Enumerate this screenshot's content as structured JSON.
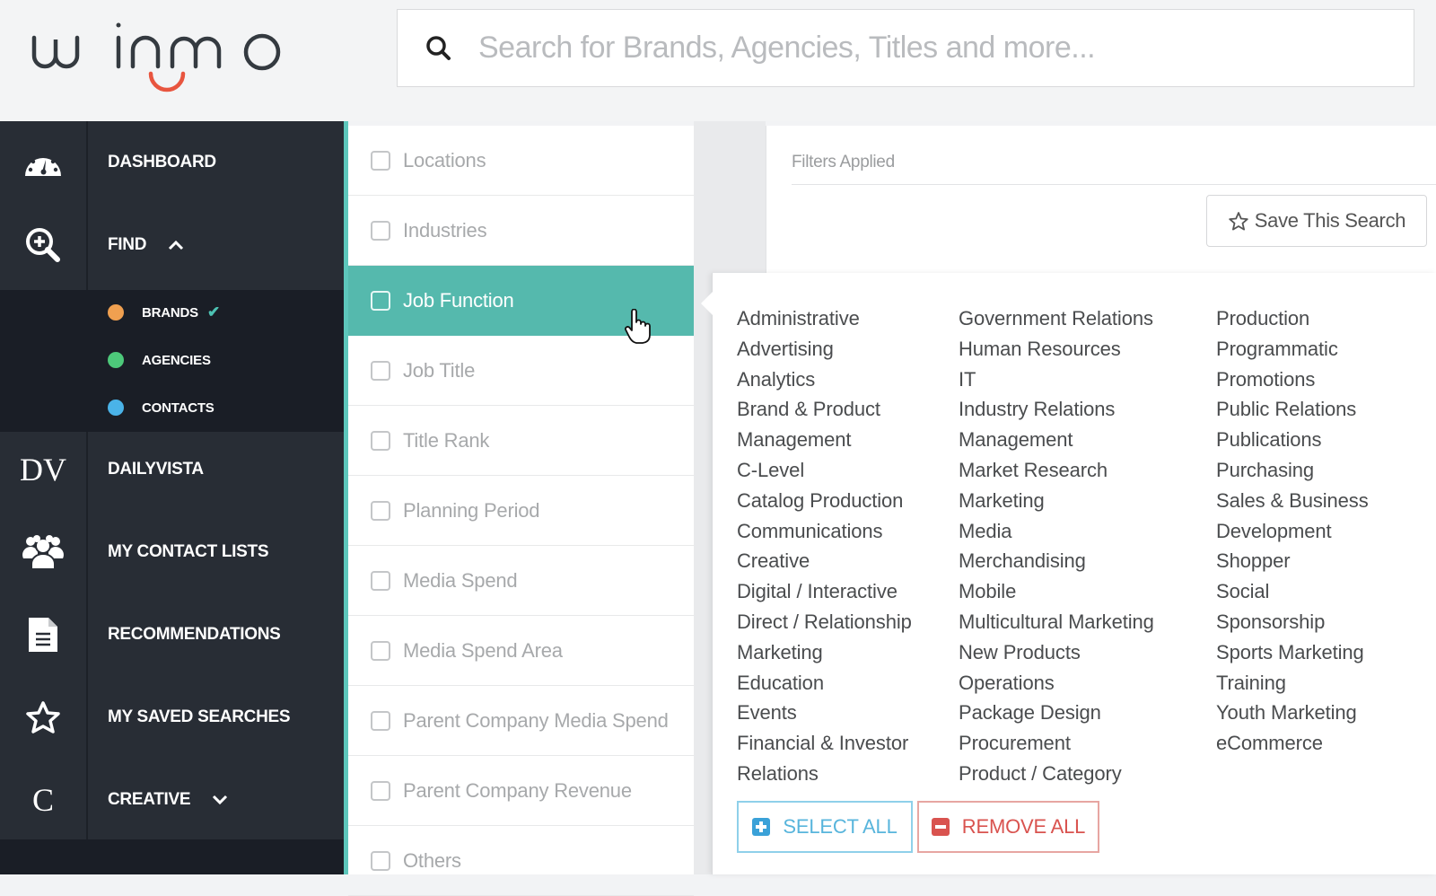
{
  "brand": {
    "name": "winmo"
  },
  "search": {
    "placeholder": "Search for Brands, Agencies, Titles and more..."
  },
  "sidebar": {
    "items": [
      {
        "label": "DASHBOARD",
        "icon": "dashboard-gauge-icon"
      },
      {
        "label": "FIND",
        "icon": "search-plus-icon",
        "expanded": true
      },
      {
        "label": "DAILYVISTA",
        "icon": "dailyvista-icon",
        "glyph": "DV"
      },
      {
        "label": "MY CONTACT LISTS",
        "icon": "users-group-icon"
      },
      {
        "label": "RECOMMENDATIONS",
        "icon": "document-icon"
      },
      {
        "label": "MY SAVED SEARCHES",
        "icon": "star-icon"
      },
      {
        "label": "CREATIVE",
        "icon": "creative-icon",
        "glyph": "C",
        "expanded": false
      }
    ],
    "find_sub": [
      {
        "label": "BRANDS",
        "color": "#f0a050",
        "selected": true
      },
      {
        "label": "AGENCIES",
        "color": "#4dc97a"
      },
      {
        "label": "CONTACTS",
        "color": "#4ab3e8"
      }
    ]
  },
  "filters": {
    "items": [
      {
        "label": "Locations",
        "checked": false
      },
      {
        "label": "Industries",
        "checked": false
      },
      {
        "label": "Job Function",
        "checked": false,
        "active": true
      },
      {
        "label": "Job Title",
        "checked": false
      },
      {
        "label": "Title Rank",
        "checked": false
      },
      {
        "label": "Planning Period",
        "checked": false
      },
      {
        "label": "Media Spend",
        "checked": false
      },
      {
        "label": "Media Spend Area",
        "checked": false
      },
      {
        "label": "Parent Company Media Spend",
        "checked": false
      },
      {
        "label": "Parent Company Revenue",
        "checked": false
      },
      {
        "label": "Others",
        "checked": false
      }
    ]
  },
  "applied": {
    "title": "Filters Applied",
    "save_label": "Save This Search"
  },
  "job_function": {
    "columns": [
      [
        "Administrative",
        "Advertising",
        "Analytics",
        "Brand & Product",
        "Management",
        "C-Level",
        "Catalog Production",
        "Communications",
        "Creative",
        "Digital / Interactive",
        "Direct / Relationship",
        "Marketing",
        "Education",
        "Events",
        "Financial & Investor",
        "Relations"
      ],
      [
        "Government Relations",
        "Human Resources",
        "IT",
        "Industry Relations",
        "Management",
        "Market Research",
        "Marketing",
        "Media",
        "Merchandising",
        "Mobile",
        "Multicultural Marketing",
        "New Products",
        "Operations",
        "Package Design",
        "Procurement",
        "Product / Category"
      ],
      [
        "Production",
        "Programmatic",
        "Promotions",
        "Public Relations",
        "Publications",
        "Purchasing",
        "Sales & Business",
        "Development",
        "Shopper",
        "Social",
        "Sponsorship",
        "Sports Marketing",
        "Training",
        "Youth Marketing",
        "eCommerce"
      ]
    ],
    "select_all_label": "SELECT ALL",
    "remove_all_label": "REMOVE ALL"
  },
  "colors": {
    "accent_teal": "#55b9ad",
    "sidebar_bg": "#282d35",
    "logo_smile": "#e8553f"
  }
}
